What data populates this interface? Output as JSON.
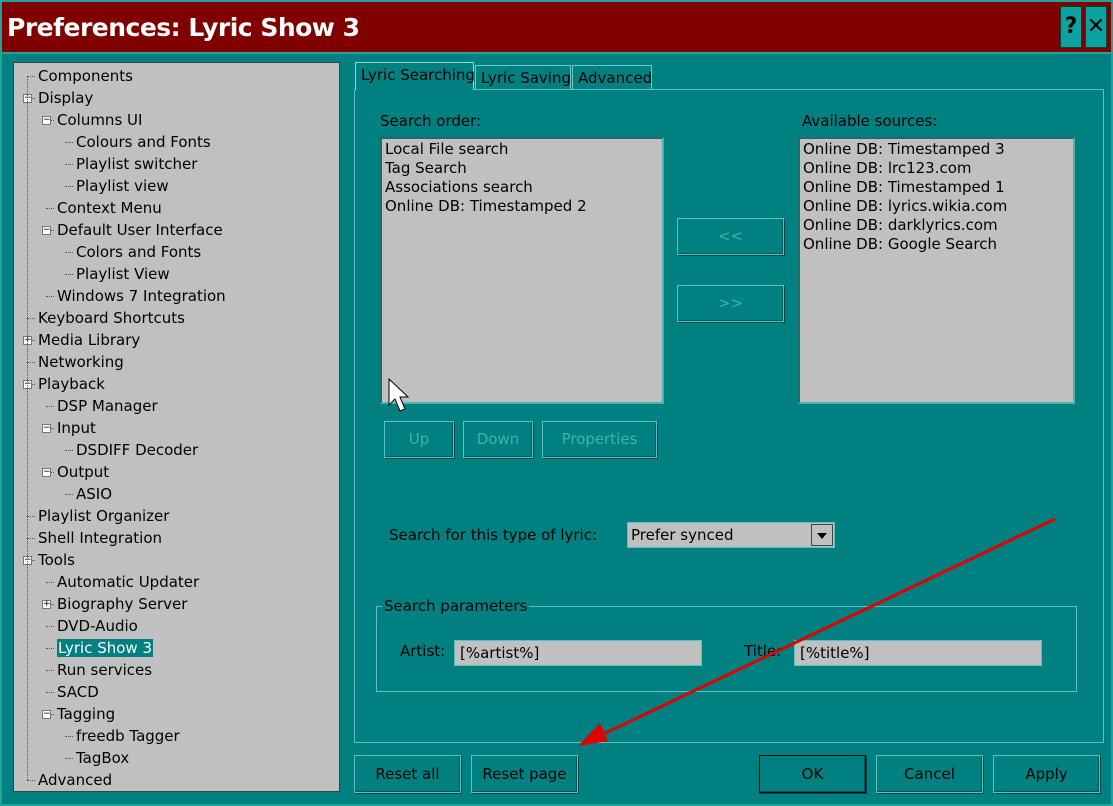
{
  "window": {
    "title": "Preferences: Lyric Show 3",
    "help_glyph": "?",
    "close_glyph": "✕"
  },
  "tree": [
    {
      "label": "Components",
      "level": 0
    },
    {
      "label": "Display",
      "level": 0,
      "expander": "minus"
    },
    {
      "label": "Columns UI",
      "level": 1,
      "expander": "minus"
    },
    {
      "label": "Colours and Fonts",
      "level": 2
    },
    {
      "label": "Playlist switcher",
      "level": 2
    },
    {
      "label": "Playlist view",
      "level": 2
    },
    {
      "label": "Context Menu",
      "level": 1
    },
    {
      "label": "Default User Interface",
      "level": 1,
      "expander": "minus"
    },
    {
      "label": "Colors and Fonts",
      "level": 2
    },
    {
      "label": "Playlist View",
      "level": 2
    },
    {
      "label": "Windows 7 Integration",
      "level": 1
    },
    {
      "label": "Keyboard Shortcuts",
      "level": 0
    },
    {
      "label": "Media Library",
      "level": 0,
      "expander": "plus"
    },
    {
      "label": "Networking",
      "level": 0
    },
    {
      "label": "Playback",
      "level": 0,
      "expander": "minus"
    },
    {
      "label": "DSP Manager",
      "level": 1
    },
    {
      "label": "Input",
      "level": 1,
      "expander": "minus"
    },
    {
      "label": "DSDIFF Decoder",
      "level": 2
    },
    {
      "label": "Output",
      "level": 1,
      "expander": "minus"
    },
    {
      "label": "ASIO",
      "level": 2
    },
    {
      "label": "Playlist Organizer",
      "level": 0
    },
    {
      "label": "Shell Integration",
      "level": 0
    },
    {
      "label": "Tools",
      "level": 0,
      "expander": "minus"
    },
    {
      "label": "Automatic Updater",
      "level": 1
    },
    {
      "label": "Biography Server",
      "level": 1,
      "expander": "plus"
    },
    {
      "label": "DVD-Audio",
      "level": 1
    },
    {
      "label": "Lyric Show 3",
      "level": 1,
      "selected": true
    },
    {
      "label": "Run services",
      "level": 1
    },
    {
      "label": "SACD",
      "level": 1
    },
    {
      "label": "Tagging",
      "level": 1,
      "expander": "minus"
    },
    {
      "label": "freedb Tagger",
      "level": 2
    },
    {
      "label": "TagBox",
      "level": 2
    },
    {
      "label": "Advanced",
      "level": 0
    }
  ],
  "tabs": [
    "Lyric Searching",
    "Lyric Saving",
    "Advanced"
  ],
  "search_order": {
    "label": "Search order:",
    "items": [
      "Local File search",
      "Tag Search",
      "Associations search",
      "Online DB: Timestamped 2"
    ]
  },
  "available": {
    "label": "Available sources:",
    "items": [
      "Online DB: Timestamped 3",
      "Online DB: lrc123.com",
      "Online DB: Timestamped 1",
      "Online DB: lyrics.wikia.com",
      "Online DB: darklyrics.com",
      "Online DB: Google Search"
    ]
  },
  "move_left": "<<",
  "move_right": ">>",
  "order_buttons": {
    "up": "Up",
    "down": "Down",
    "properties": "Properties"
  },
  "lyric_type": {
    "label": "Search for this type of lyric:",
    "value": "Prefer synced"
  },
  "params": {
    "title": "Search parameters",
    "artist_label": "Artist:",
    "artist_value": "[%artist%]",
    "title_label": "Title:",
    "title_value": "[%title%]"
  },
  "bottom": {
    "reset_all": "Reset all",
    "reset_page": "Reset page",
    "ok": "OK",
    "cancel": "Cancel",
    "apply": "Apply"
  },
  "colors": {
    "titlebar": "#800000",
    "face": "#008080",
    "list_bg": "#c0c0c0",
    "annotation": "#e00000"
  }
}
